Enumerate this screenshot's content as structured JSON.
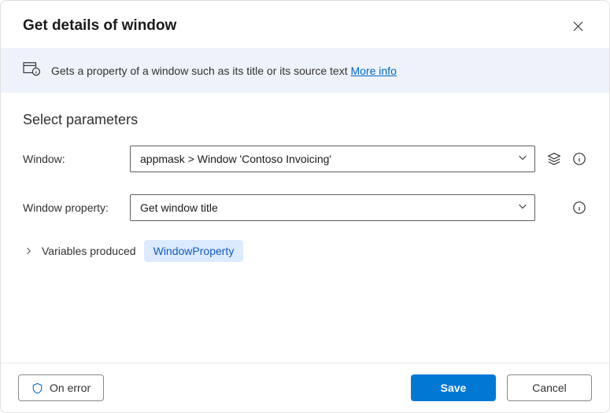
{
  "header": {
    "title": "Get details of window"
  },
  "banner": {
    "text": "Gets a property of a window such as its title or its source text ",
    "link": "More info"
  },
  "section": {
    "title": "Select parameters"
  },
  "field_window": {
    "label": "Window:",
    "value": "appmask > Window 'Contoso Invoicing'"
  },
  "field_property": {
    "label": "Window property:",
    "value": "Get window title"
  },
  "variables": {
    "label": "Variables produced",
    "chip": "WindowProperty"
  },
  "buttons": {
    "on_error": "On error",
    "save": "Save",
    "cancel": "Cancel"
  }
}
